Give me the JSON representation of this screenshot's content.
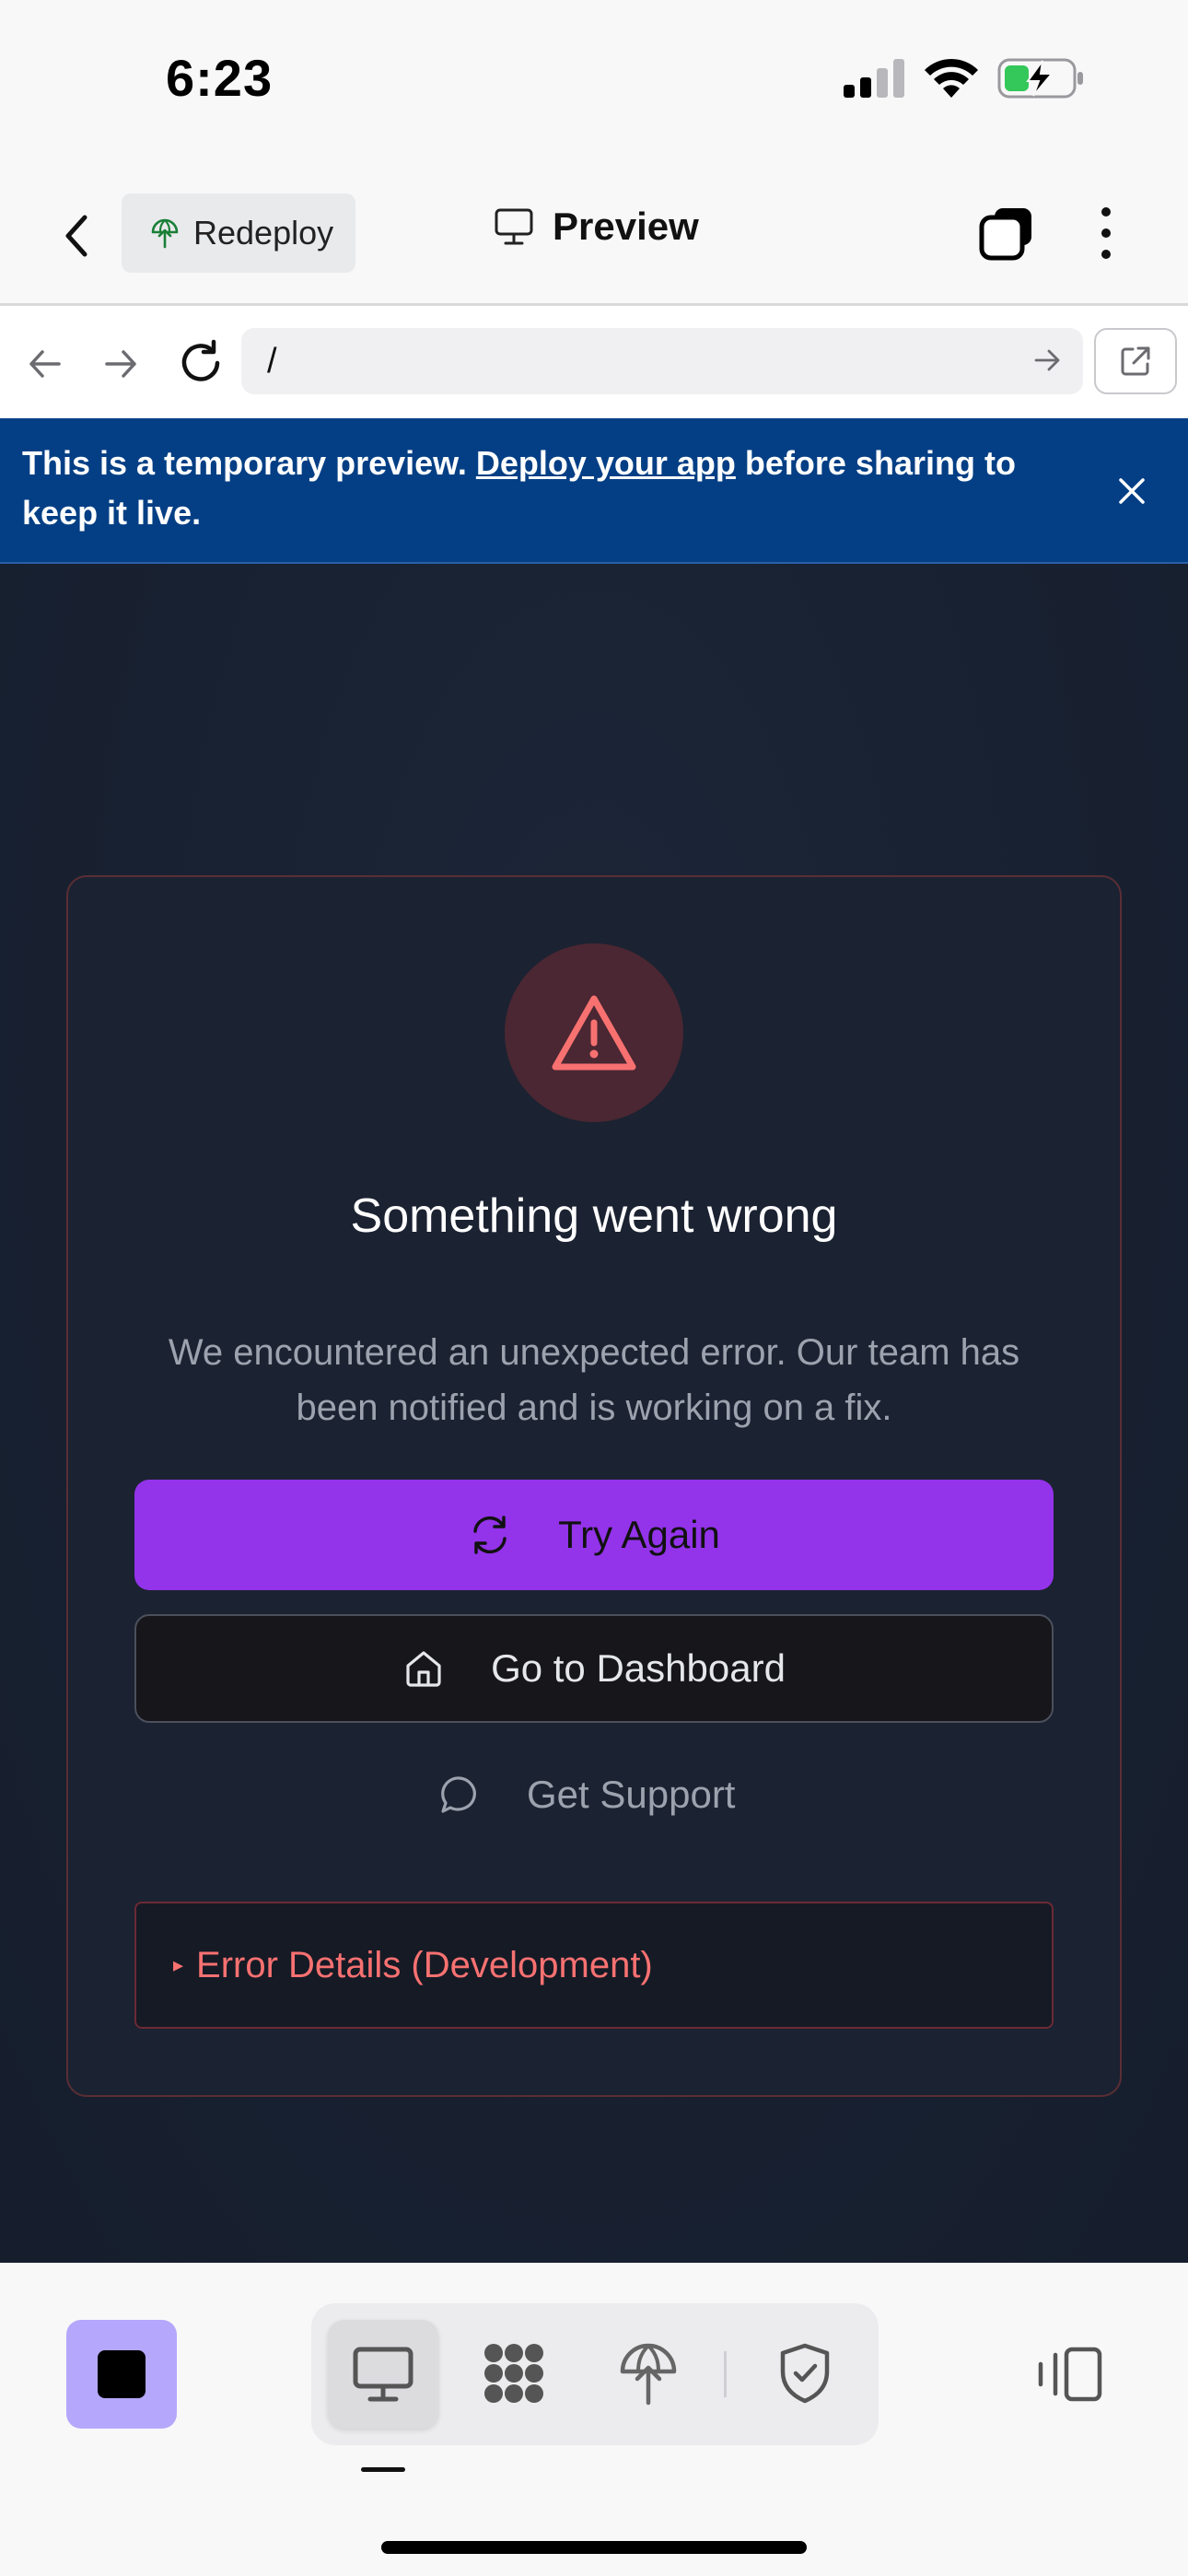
{
  "status_bar": {
    "time": "6:23"
  },
  "header": {
    "redeploy_label": "Redeploy",
    "title": "Preview"
  },
  "browser": {
    "url": "/"
  },
  "banner": {
    "text_before": "This is a temporary preview. ",
    "link_text": "Deploy your app",
    "text_after": " before sharing to keep it live."
  },
  "error_card": {
    "title": "Something went wrong",
    "description": "We encountered an unexpected error. Our team has been notified and is working on a fix.",
    "try_again_label": "Try Again",
    "dashboard_label": "Go to Dashboard",
    "support_label": "Get Support",
    "details_label": "Error Details (Development)",
    "details_marker": "▸"
  },
  "icons": {
    "header": [
      "chevron-left-icon",
      "deploy-icon",
      "monitor-icon",
      "tabs-icon",
      "more-vertical-icon"
    ],
    "browser": [
      "arrow-left-icon",
      "arrow-right-icon",
      "reload-icon",
      "go-arrow-icon",
      "external-link-icon"
    ],
    "bottom": [
      "stop-icon",
      "monitor-icon",
      "apps-icon",
      "deploy-icon",
      "shield-check-icon",
      "panel-toggle-icon"
    ]
  },
  "colors": {
    "banner": "#043f85",
    "primary_button": "#9333ea",
    "error_accent": "#f87171",
    "stop_button": "#b5a7fb"
  }
}
